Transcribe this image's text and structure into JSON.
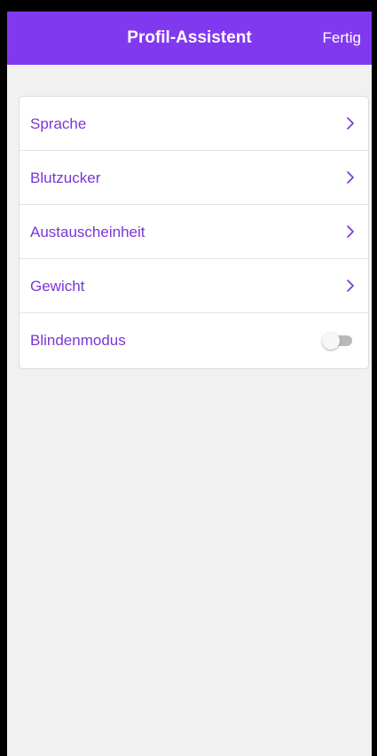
{
  "header": {
    "title": "Profil-Assistent",
    "done_label": "Fertig",
    "background_color": "#8139f0"
  },
  "settings": {
    "items": [
      {
        "label": "Sprache",
        "type": "link",
        "icon": "chevron-right-icon"
      },
      {
        "label": "Blutzucker",
        "type": "link",
        "icon": "chevron-right-icon"
      },
      {
        "label": "Austauscheinheit",
        "type": "link",
        "icon": "chevron-right-icon"
      },
      {
        "label": "Gewicht",
        "type": "link",
        "icon": "chevron-right-icon"
      },
      {
        "label": "Blindenmodus",
        "type": "toggle",
        "checked": false
      }
    ]
  },
  "colors": {
    "accent": "#8139f0",
    "label_text": "#7a36d6",
    "background": "#f1f1f1"
  }
}
